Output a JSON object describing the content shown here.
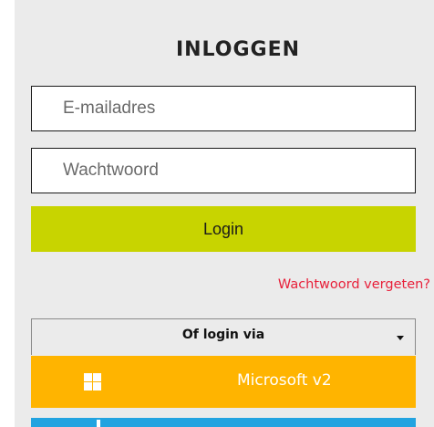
{
  "login": {
    "title": "INLOGGEN",
    "email_placeholder": "E-mailadres",
    "password_placeholder": "Wachtwoord",
    "login_label": "Login",
    "forgot_password": "Wachtwoord vergeten?"
  },
  "external_login": {
    "dropdown_label": "Of login via",
    "providers": [
      {
        "label": "Microsoft v2",
        "icon": "windows-icon",
        "color": "#ffb400"
      },
      {
        "label": "",
        "icon": "provider-icon",
        "color": "#22a3e0"
      }
    ]
  },
  "colors": {
    "accent": "#c8d400",
    "link": "#e8203a",
    "panel_background": "#ebebeb"
  }
}
